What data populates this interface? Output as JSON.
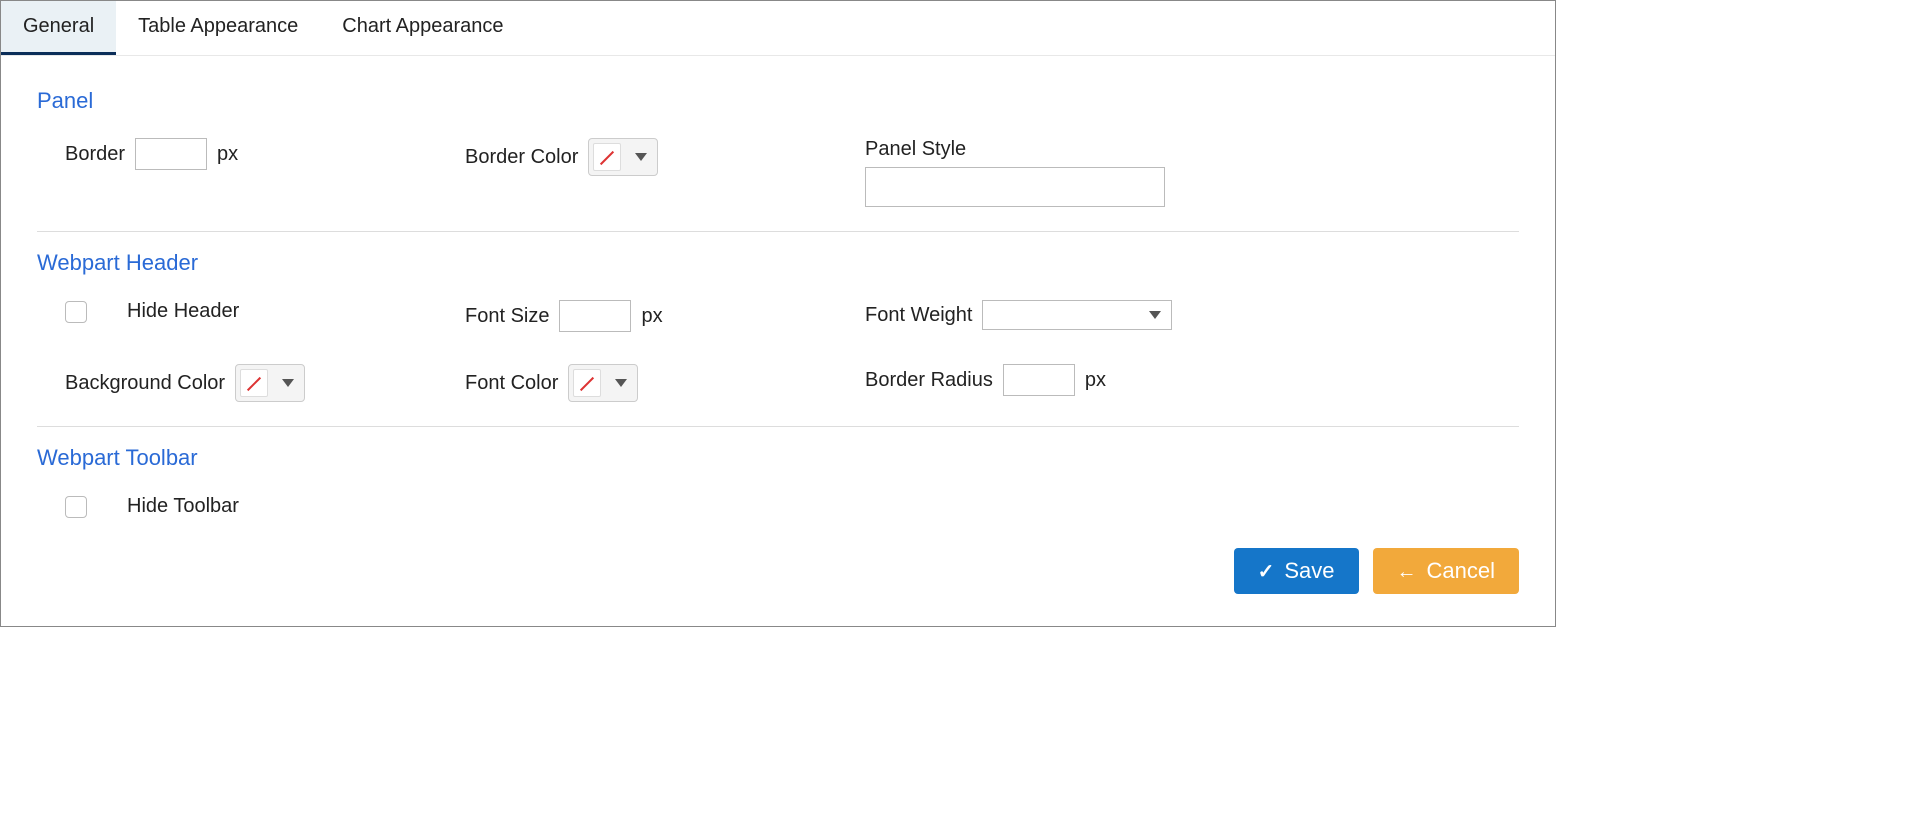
{
  "tabs": {
    "general": "General",
    "table_appearance": "Table Appearance",
    "chart_appearance": "Chart Appearance"
  },
  "panel": {
    "title": "Panel",
    "border_label": "Border",
    "border_value": "",
    "border_unit": "px",
    "border_color_label": "Border Color",
    "panel_style_label": "Panel Style",
    "panel_style_value": ""
  },
  "header": {
    "title": "Webpart Header",
    "hide_header_label": "Hide Header",
    "font_size_label": "Font Size",
    "font_size_value": "",
    "font_size_unit": "px",
    "font_weight_label": "Font Weight",
    "font_weight_value": "",
    "background_color_label": "Background Color",
    "font_color_label": "Font Color",
    "border_radius_label": "Border Radius",
    "border_radius_value": "",
    "border_radius_unit": "px"
  },
  "toolbar": {
    "title": "Webpart Toolbar",
    "hide_toolbar_label": "Hide Toolbar"
  },
  "footer": {
    "save": "Save",
    "cancel": "Cancel"
  }
}
